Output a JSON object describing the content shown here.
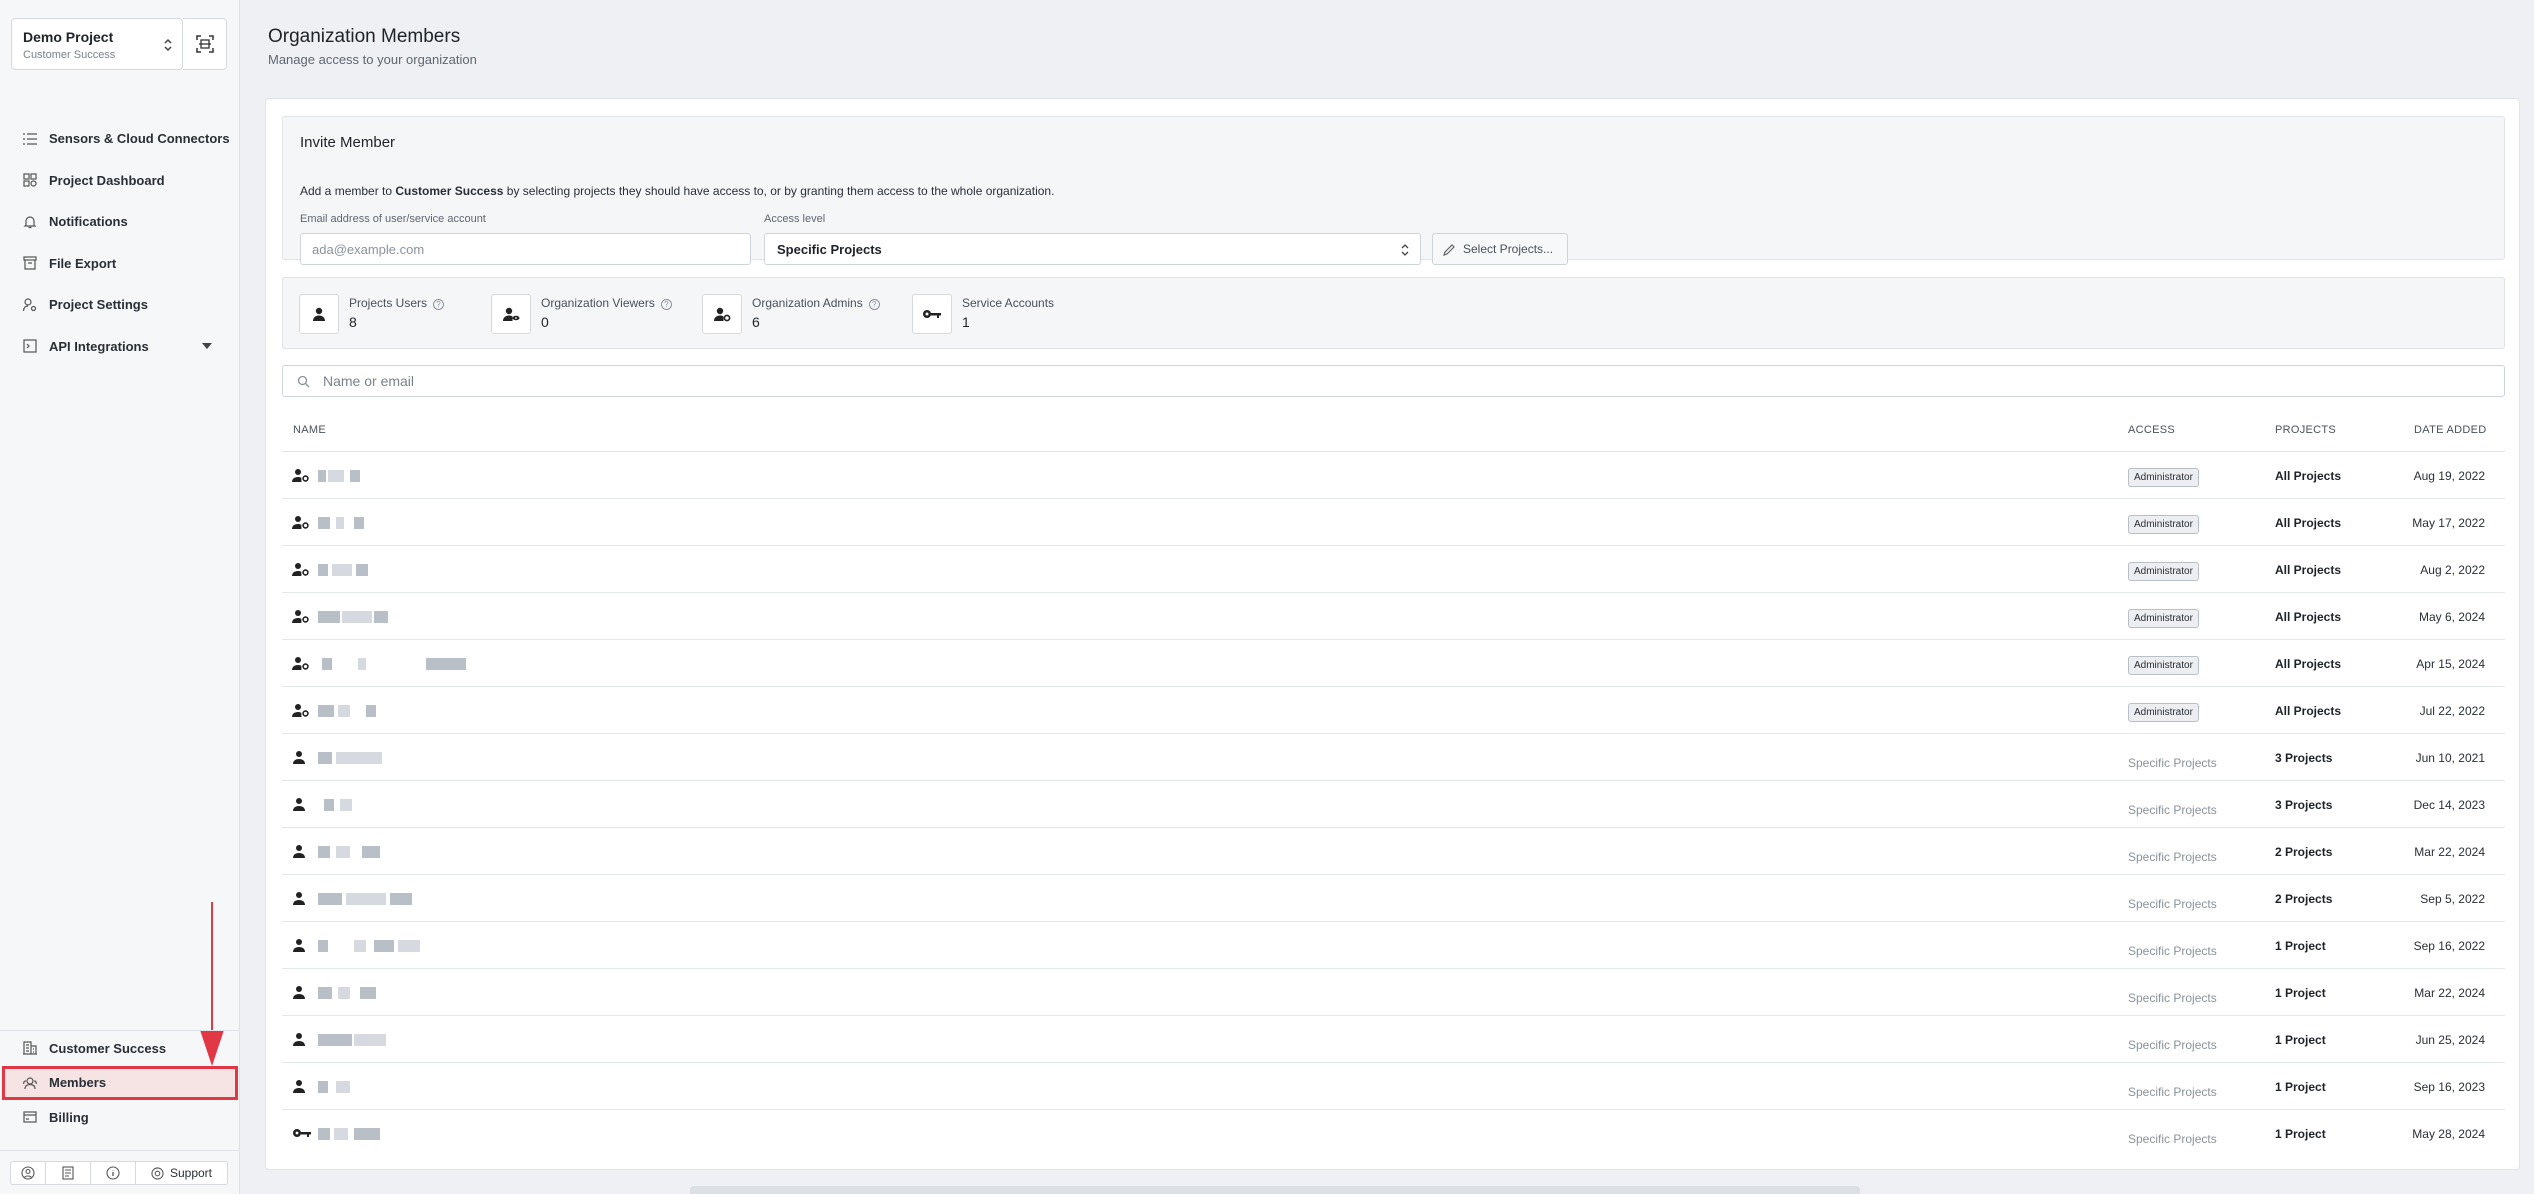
{
  "sidebar": {
    "project_name": "Demo Project",
    "project_org": "Customer Success",
    "nav": [
      {
        "label": "Sensors & Cloud Connectors",
        "icon": "list-icon"
      },
      {
        "label": "Project Dashboard",
        "icon": "dashboard-icon"
      },
      {
        "label": "Notifications",
        "icon": "bell-icon"
      },
      {
        "label": "File Export",
        "icon": "export-icon"
      },
      {
        "label": "Project Settings",
        "icon": "user-gear-icon"
      },
      {
        "label": "API Integrations",
        "icon": "terminal-icon"
      }
    ],
    "bottom_nav": [
      {
        "label": "Customer Success",
        "icon": "building-icon"
      },
      {
        "label": "Members",
        "icon": "members-icon"
      },
      {
        "label": "Billing",
        "icon": "credit-card-icon"
      }
    ],
    "footer_support": "Support"
  },
  "header": {
    "title": "Organization Members",
    "subtitle": "Manage access to your organization"
  },
  "invite": {
    "title": "Invite Member",
    "desc_prefix": "Add a member to ",
    "desc_org": "Customer Success",
    "desc_suffix": " by selecting projects they should have access to, or by granting them access to the whole organization.",
    "email_label": "Email address of user/service account",
    "email_placeholder": "ada@example.com",
    "access_label": "Access level",
    "access_value": "Specific Projects",
    "select_projects": "Select Projects..."
  },
  "stats": [
    {
      "label": "Projects Users",
      "value": "8",
      "icon": "user-icon",
      "help": true
    },
    {
      "label": "Organization Viewers",
      "value": "0",
      "icon": "user-eye-icon",
      "help": true
    },
    {
      "label": "Organization Admins",
      "value": "6",
      "icon": "user-gear-icon",
      "help": true
    },
    {
      "label": "Service Accounts",
      "value": "1",
      "icon": "key-icon",
      "help": false
    }
  ],
  "search": {
    "placeholder": "Name or email"
  },
  "table": {
    "headers": {
      "name": "NAME",
      "access": "ACCESS",
      "projects": "PROJECTS",
      "date": "DATE ADDED"
    },
    "rows": [
      {
        "type": "admin",
        "access": "Administrator",
        "projects": "All Projects",
        "date": "Aug 19, 2022"
      },
      {
        "type": "admin",
        "access": "Administrator",
        "projects": "All Projects",
        "date": "May 17, 2022"
      },
      {
        "type": "admin",
        "access": "Administrator",
        "projects": "All Projects",
        "date": "Aug 2, 2022"
      },
      {
        "type": "admin",
        "access": "Administrator",
        "projects": "All Projects",
        "date": "May 6, 2024"
      },
      {
        "type": "admin",
        "access": "Administrator",
        "projects": "All Projects",
        "date": "Apr 15, 2024"
      },
      {
        "type": "admin",
        "access": "Administrator",
        "projects": "All Projects",
        "date": "Jul 22, 2022"
      },
      {
        "type": "user",
        "access": "Specific Projects",
        "projects": "3 Projects",
        "date": "Jun 10, 2021"
      },
      {
        "type": "user",
        "access": "Specific Projects",
        "projects": "3 Projects",
        "date": "Dec 14, 2023"
      },
      {
        "type": "user",
        "access": "Specific Projects",
        "projects": "2 Projects",
        "date": "Mar 22, 2024"
      },
      {
        "type": "user",
        "access": "Specific Projects",
        "projects": "2 Projects",
        "date": "Sep 5, 2022"
      },
      {
        "type": "user",
        "access": "Specific Projects",
        "projects": "1 Project",
        "date": "Sep 16, 2022"
      },
      {
        "type": "user",
        "access": "Specific Projects",
        "projects": "1 Project",
        "date": "Mar 22, 2024"
      },
      {
        "type": "user",
        "access": "Specific Projects",
        "projects": "1 Project",
        "date": "Jun 25, 2024"
      },
      {
        "type": "user",
        "access": "Specific Projects",
        "projects": "1 Project",
        "date": "Sep 16, 2023"
      },
      {
        "type": "service",
        "access": "Specific Projects",
        "projects": "1 Project",
        "date": "May 28, 2024"
      }
    ]
  }
}
